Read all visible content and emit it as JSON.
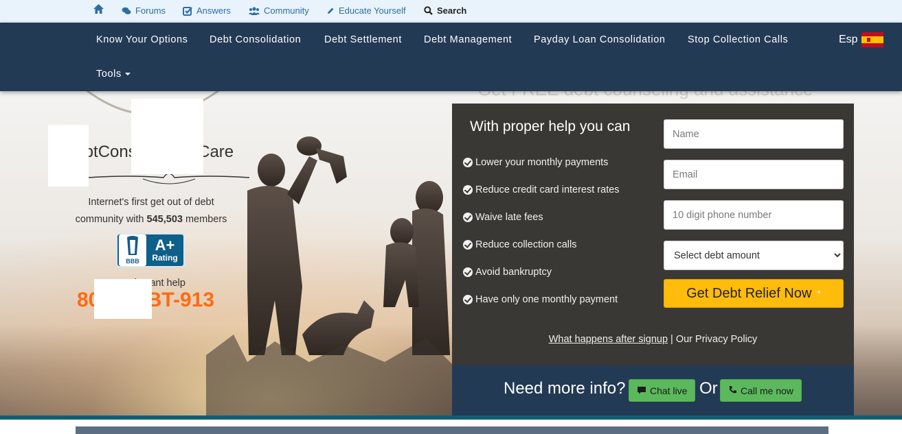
{
  "topbar": {
    "items": [
      {
        "label": "",
        "icon": "home-icon"
      },
      {
        "label": "Forums",
        "icon": "comments-icon"
      },
      {
        "label": "Answers",
        "icon": "check-square-icon"
      },
      {
        "label": "Community",
        "icon": "users-icon"
      },
      {
        "label": "Educate Yourself",
        "icon": "pencil-icon"
      },
      {
        "label": "Search",
        "icon": "search-icon"
      }
    ]
  },
  "nav": {
    "links": [
      "Know Your Options",
      "Debt Consolidation",
      "Debt Settlement",
      "Debt Management",
      "Payday Loan Consolidation",
      "Stop Collection Calls"
    ],
    "tools_label": "Tools",
    "language_label": "Esp",
    "language_flag": "spain-flag-icon"
  },
  "hero": {
    "faded_heading": "Get FREE debt counseling and assistance",
    "brand_name": "DebtConsolidationCare",
    "tagline_line1": "Internet's first get out of debt",
    "tagline_line2_prefix": "community with ",
    "member_count": "545,503",
    "tagline_line2_suffix": " members",
    "bbb_logo_text": "BBB",
    "bbb_grade": "A+",
    "bbb_rating_text": "Rating",
    "instant_help_label": "For instant help",
    "phone_number": "800-DEBT-913"
  },
  "form": {
    "title": "With proper help you can",
    "benefits": [
      "Lower your monthly payments",
      "Reduce credit card interest rates",
      "Waive late fees",
      "Reduce collection calls",
      "Avoid bankruptcy",
      "Have only one monthly payment"
    ],
    "name_placeholder": "Name",
    "email_placeholder": "Email",
    "phone_placeholder": "10 digit phone number",
    "debt_select_value": "Select debt amount",
    "submit_label": "Get Debt Relief Now",
    "submit_star": "*",
    "after_signup_link": "What happens after signup",
    "separator": " | ",
    "privacy_link": "Our Privacy Policy"
  },
  "info_bar": {
    "question": "Need more info?",
    "chat_label": "Chat live",
    "or_label": "Or",
    "call_label": "Call me now"
  },
  "colors": {
    "nav_bg": "#233a55",
    "accent_orange": "#ff6a13",
    "cta_yellow": "#ffbc0a",
    "green_button": "#5cb85c",
    "panel_bg": "#3a3835"
  }
}
